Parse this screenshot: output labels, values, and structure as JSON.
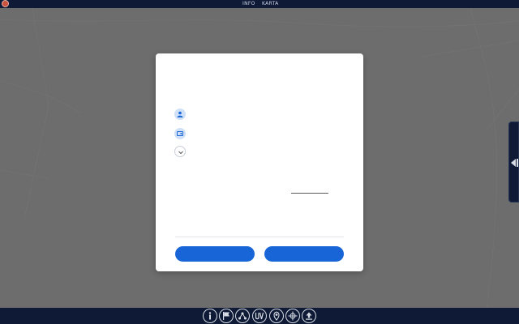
{
  "topbar": {
    "tabs": [
      {
        "label": "INFO"
      },
      {
        "label": "KARTA"
      }
    ]
  },
  "dialog": {
    "rows": [
      {
        "icon": "user-icon"
      },
      {
        "icon": "id-card-icon"
      },
      {
        "icon": "chevron-down-icon"
      }
    ],
    "buttons": [
      {
        "label": ""
      },
      {
        "label": ""
      }
    ]
  },
  "bottombar": {
    "icons": [
      "info-icon",
      "flag-icon",
      "network-icon",
      "uv-icon",
      "location-icon",
      "crosshair-icon",
      "upload-icon"
    ]
  },
  "colors": {
    "topbar": "#0e1a36",
    "accent": "#1865d8",
    "overlay": "#6b6b6b"
  }
}
